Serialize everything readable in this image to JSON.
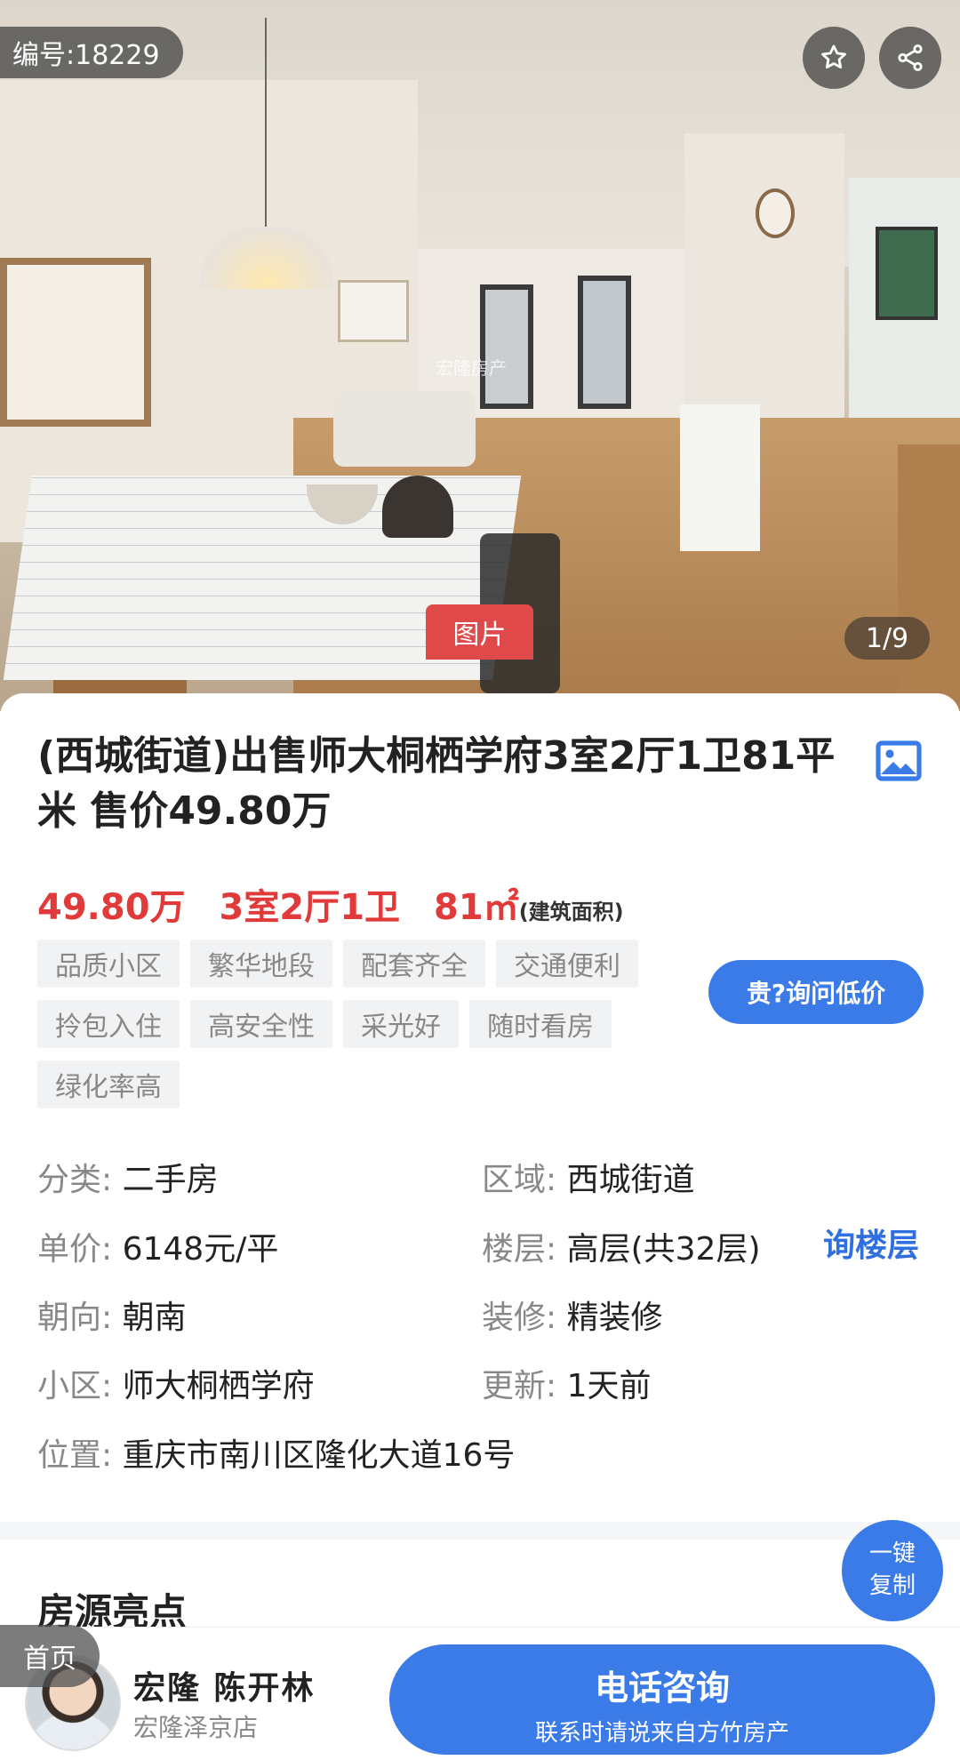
{
  "gallery": {
    "id_badge": "编号:18229",
    "photo_tag": "图片",
    "counter": "1/9",
    "watermark": "宏隆房产"
  },
  "listing": {
    "title": "(西城街道)出售师大桐栖学府3室2厅1卫81平米 售价49.80万",
    "price": "49.80万",
    "layout": "3室2厅1卫",
    "area": "81㎡",
    "area_note": "(建筑面积)",
    "tags": [
      "品质小区",
      "繁华地段",
      "配套齐全",
      "交通便利",
      "拎包入住",
      "高安全性",
      "采光好",
      "随时看房",
      "绿化率高"
    ],
    "ask_price_button": "贵?询问低价"
  },
  "details": {
    "category_label": "分类:",
    "category_value": "二手房",
    "region_label": "区域:",
    "region_value": "西城街道",
    "unit_price_label": "单价:",
    "unit_price_value": "6148元/平",
    "floor_label": "楼层:",
    "floor_value": "高层(共32层)",
    "floor_action": "询楼层",
    "orientation_label": "朝向:",
    "orientation_value": "朝南",
    "decoration_label": "装修:",
    "decoration_value": "精装修",
    "community_label": "小区:",
    "community_value": "师大桐栖学府",
    "updated_label": "更新:",
    "updated_value": "1天前",
    "location_label": "位置:",
    "location_value": "重庆市南川区隆化大道16号"
  },
  "copy_button": {
    "line1": "一键",
    "line2": "复制"
  },
  "section": {
    "highlights_title": "房源亮点"
  },
  "bottom": {
    "home_tab": "首页",
    "agent_name": "宏隆 陈开林",
    "agent_store": "宏隆泽京店",
    "call_title": "电话咨询",
    "call_subtitle": "联系时请说来自方竹房产"
  },
  "colors": {
    "accent_blue": "#3b7be8",
    "price_red": "#e03a3a",
    "tag_bg": "#f1f2f4"
  },
  "icons": [
    "star-icon",
    "share-icon",
    "album-icon"
  ]
}
